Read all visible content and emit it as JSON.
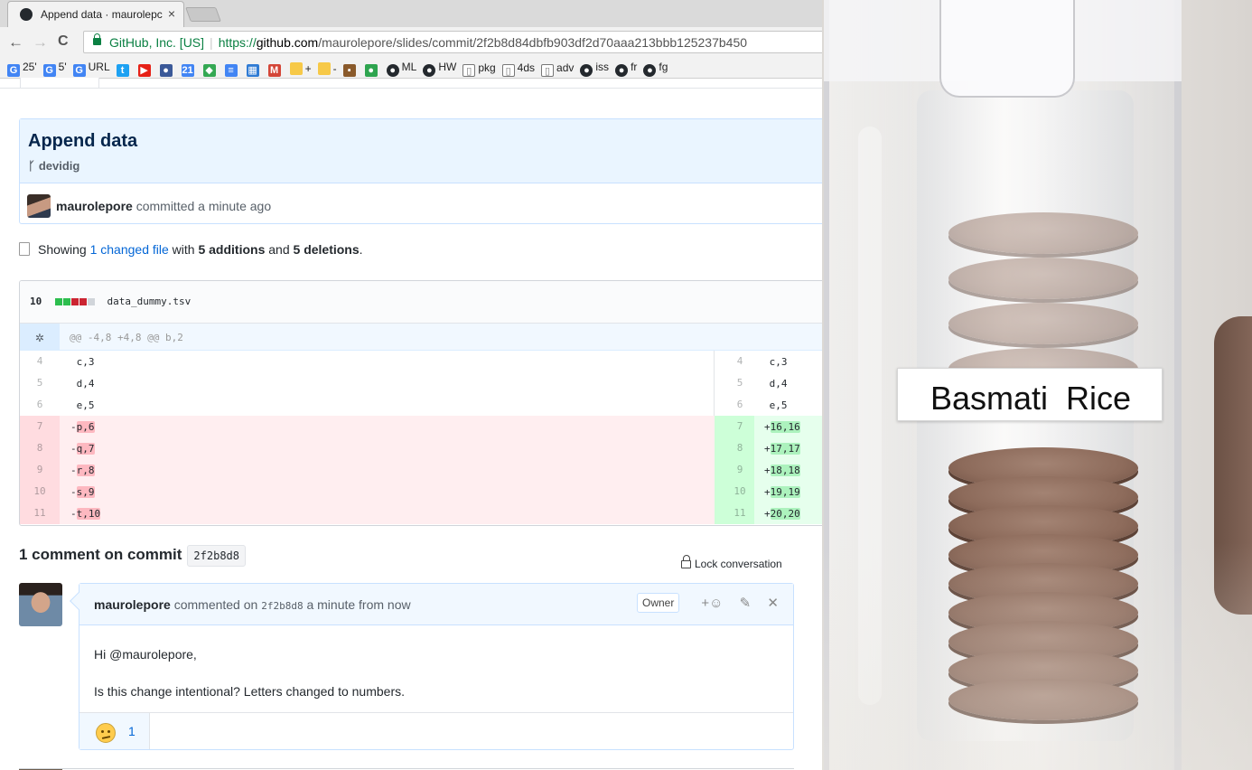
{
  "browser": {
    "tab_title": "Append data · maurolepc",
    "tab_close": "×",
    "back_glyph": "←",
    "forward_glyph": "→",
    "reload_glyph": "C",
    "secure_label": "GitHub, Inc. [US]",
    "url_scheme": "https://",
    "url_host": "github.com",
    "url_path": "/maurolepore/slides/commit/2f2b8d84dbfb903df2d70aaa213bbb125237b450",
    "bookmarks": [
      {
        "icon": "google-icon",
        "label": "25'",
        "color": "#4285f4",
        "glyph": "G"
      },
      {
        "icon": "google-icon",
        "label": "5'",
        "color": "#4285f4",
        "glyph": "G"
      },
      {
        "icon": "google-icon",
        "label": "URL",
        "color": "#4285f4",
        "glyph": "G"
      },
      {
        "icon": "twitter-icon",
        "label": "",
        "color": "#1da1f2",
        "glyph": "t"
      },
      {
        "icon": "youtube-icon",
        "label": "",
        "color": "#e62117",
        "glyph": "▶"
      },
      {
        "icon": "account-icon",
        "label": "",
        "color": "#3b5998",
        "glyph": "●"
      },
      {
        "icon": "calendar-icon",
        "label": "",
        "color": "#4285f4",
        "glyph": "21"
      },
      {
        "icon": "maps-icon",
        "label": "",
        "color": "#34a853",
        "glyph": "◆"
      },
      {
        "icon": "docs-icon",
        "label": "",
        "color": "#4285f4",
        "glyph": "≡"
      },
      {
        "icon": "sheets-icon",
        "label": "",
        "color": "#2f7bd4",
        "glyph": "▦"
      },
      {
        "icon": "gmail-icon",
        "label": "",
        "color": "#d44638",
        "glyph": "M"
      },
      {
        "icon": "keep-icon",
        "label": "+",
        "color": "#f7c948",
        "glyph": ""
      },
      {
        "icon": "keep-icon",
        "label": "-",
        "color": "#f7c948",
        "glyph": ""
      },
      {
        "icon": "box-icon",
        "label": "",
        "color": "#8a5a2b",
        "glyph": "▪"
      },
      {
        "icon": "github-icon",
        "label": "",
        "color": "#2ea44f",
        "glyph": "●"
      },
      {
        "icon": "github-icon",
        "label": "ML",
        "color": "#24292e",
        "glyph": "●"
      },
      {
        "icon": "github-icon",
        "label": "HW",
        "color": "#24292e",
        "glyph": "●"
      },
      {
        "icon": "page-icon",
        "label": "pkg",
        "color": "#ffffff",
        "glyph": "▯"
      },
      {
        "icon": "page-icon",
        "label": "4ds",
        "color": "#ffffff",
        "glyph": "▯"
      },
      {
        "icon": "page-icon",
        "label": "adv",
        "color": "#ffffff",
        "glyph": "▯"
      },
      {
        "icon": "github-icon",
        "label": "iss",
        "color": "#24292e",
        "glyph": "●"
      },
      {
        "icon": "github-icon",
        "label": "fr",
        "color": "#24292e",
        "glyph": "●"
      },
      {
        "icon": "github-icon",
        "label": "fg",
        "color": "#24292e",
        "glyph": "●"
      }
    ]
  },
  "commit": {
    "title": "Append data",
    "branch": "devidig",
    "author": "maurolepore",
    "committed_text": "committed a minute ago"
  },
  "summary": {
    "prefix": "Showing",
    "changed_files": "1 changed file",
    "with_text": "with",
    "additions": "5 additions",
    "and_text": "and",
    "deletions": "5 deletions",
    "suffix": "."
  },
  "file": {
    "change_count": "10",
    "diffstat_colors": [
      "#2cbe4e",
      "#2cbe4e",
      "#cb2431",
      "#cb2431",
      "#d1d5da"
    ],
    "name": "data_dummy.tsv",
    "hunk_header": "@@ -4,8 +4,8 @@ b,2",
    "context_rows": [
      {
        "old": "4",
        "new": "4",
        "left": " c,3",
        "right": " c,3"
      },
      {
        "old": "5",
        "new": "5",
        "left": " d,4",
        "right": " d,4"
      },
      {
        "old": "6",
        "new": "6",
        "left": " e,5",
        "right": " e,5"
      }
    ],
    "change_rows": [
      {
        "old": "7",
        "new": "7",
        "del_sign": "-",
        "del": "p,6",
        "add_sign": "+",
        "add": "16,16"
      },
      {
        "old": "8",
        "new": "8",
        "del_sign": "-",
        "del": "q,7",
        "add_sign": "+",
        "add": "17,17"
      },
      {
        "old": "9",
        "new": "9",
        "del_sign": "-",
        "del": "r,8",
        "add_sign": "+",
        "add": "18,18"
      },
      {
        "old": "10",
        "new": "10",
        "del_sign": "-",
        "del": "s,9",
        "add_sign": "+",
        "add": "19,19"
      },
      {
        "old": "11",
        "new": "11",
        "del_sign": "-",
        "del": "t,10",
        "add_sign": "+",
        "add": "20,20"
      }
    ]
  },
  "comments": {
    "heading": "1 comment on commit",
    "sha": "2f2b8d8",
    "lock_label": "Lock conversation",
    "items": [
      {
        "author": "maurolepore",
        "commented_on": "commented on",
        "sha": "2f2b8d8",
        "time": "a minute from now",
        "badge": "Owner",
        "add_reaction": "+☺",
        "edit_glyph": "✎",
        "delete_glyph": "✕",
        "greeting": "Hi @maurolepore,",
        "body": "Is this change intentional? Letters changed to numbers.",
        "reaction_count": "1"
      }
    ]
  },
  "photo": {
    "label_text": "Basmati Rice"
  }
}
